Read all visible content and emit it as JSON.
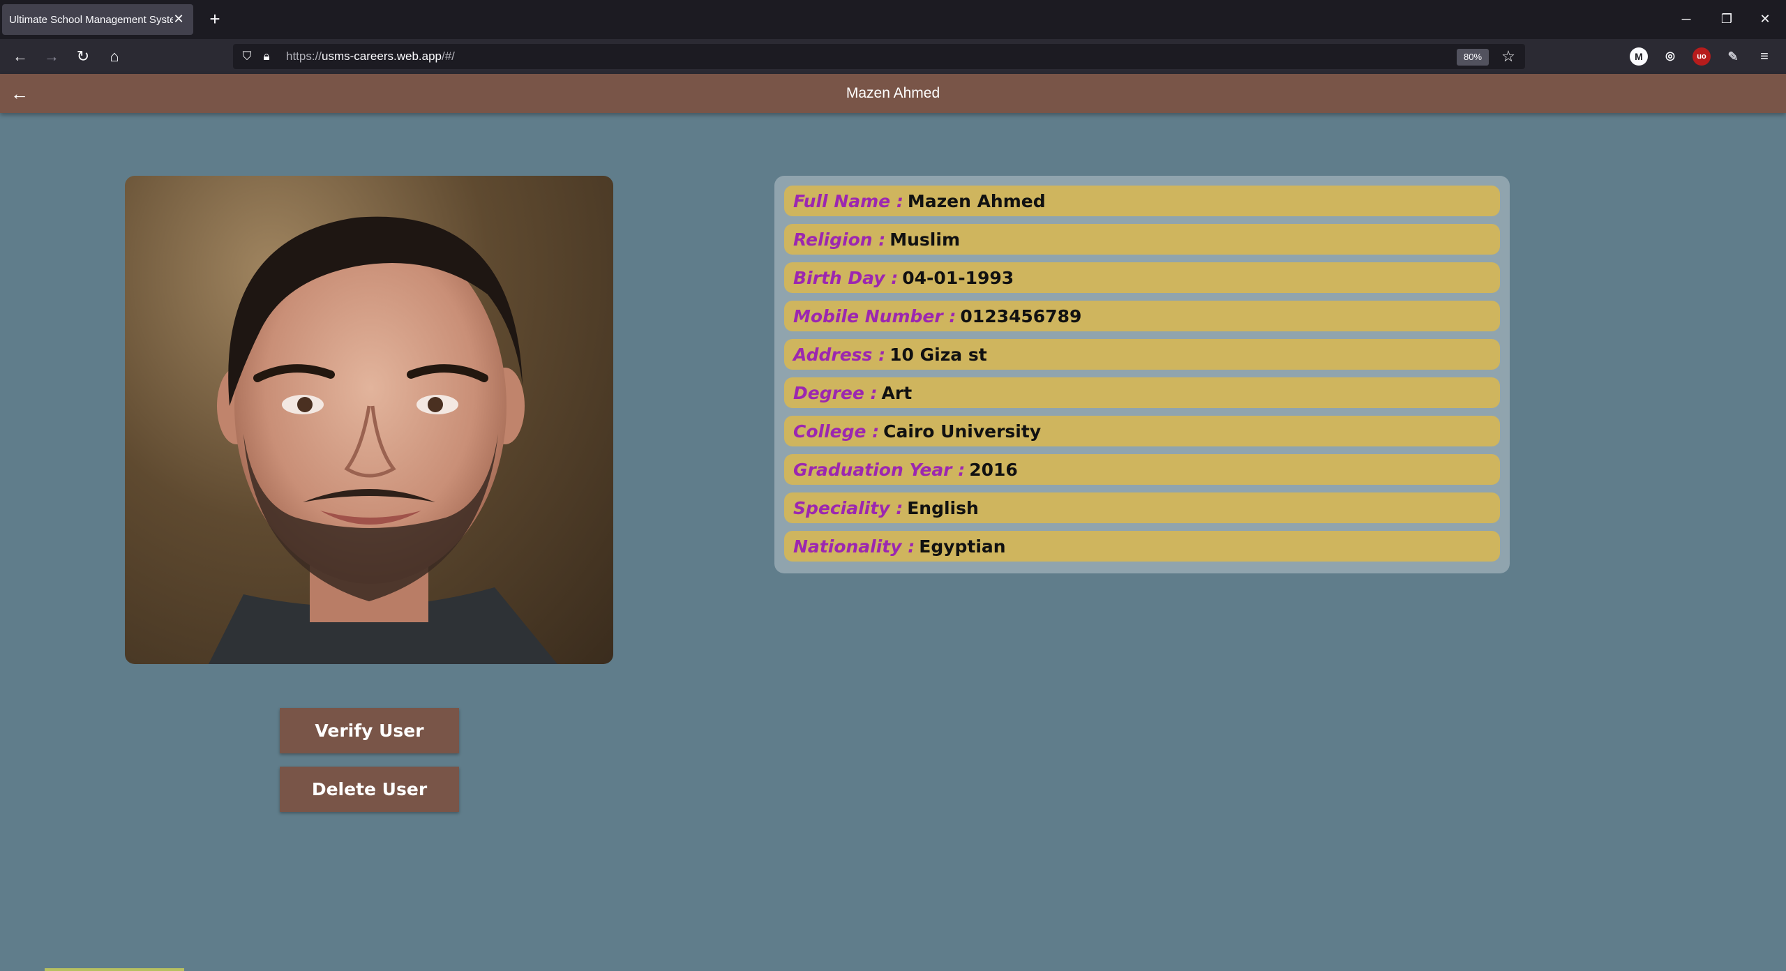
{
  "browser": {
    "tab_title": "Ultimate School Management Syste",
    "url_prefix": "https://",
    "url_host": "usms-careers.web.app",
    "url_path": "/#/",
    "zoom": "80%"
  },
  "app": {
    "title": "Mazen Ahmed"
  },
  "actions": {
    "verify_label": "Verify User",
    "delete_label": "Delete User"
  },
  "profile": [
    {
      "label": "Full Name :",
      "value": "Mazen Ahmed"
    },
    {
      "label": "Religion :",
      "value": "Muslim"
    },
    {
      "label": "Birth Day :",
      "value": "04-01-1993"
    },
    {
      "label": "Mobile Number :",
      "value": "0123456789"
    },
    {
      "label": "Address :",
      "value": "10 Giza st"
    },
    {
      "label": "Degree :",
      "value": "Art"
    },
    {
      "label": "College :",
      "value": "Cairo University"
    },
    {
      "label": "Graduation Year :",
      "value": "2016"
    },
    {
      "label": "Speciality :",
      "value": "English"
    },
    {
      "label": "Nationality :",
      "value": "Egyptian"
    }
  ],
  "colors": {
    "appbar": "#795548",
    "background": "#607d8b",
    "card": "#90a4ae",
    "row": "#cfb55e",
    "label": "#9c27b0"
  }
}
